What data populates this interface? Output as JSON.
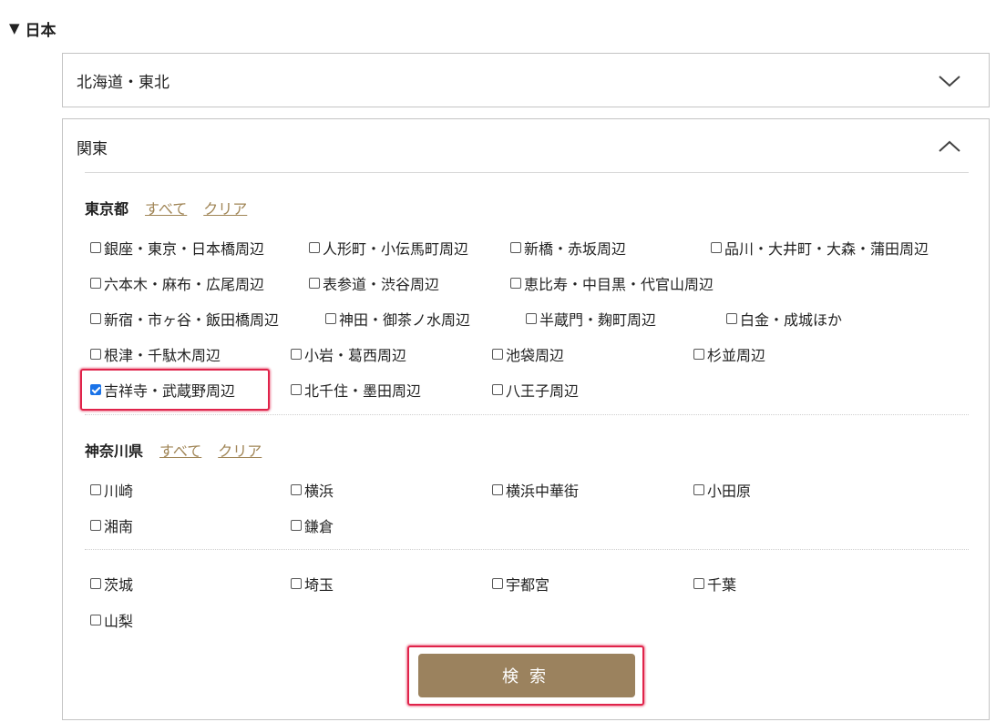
{
  "section": {
    "icon": "triangle-down-icon",
    "title": "日本"
  },
  "panels": [
    {
      "title": "北海道・東北",
      "expanded": false
    },
    {
      "title": "関東",
      "expanded": true
    }
  ],
  "tokyo": {
    "name": "東京都",
    "all_label": "すべて",
    "clear_label": "クリア",
    "options": [
      {
        "label": "銀座・東京・日本橋周辺",
        "checked": false
      },
      {
        "label": "人形町・小伝馬町周辺",
        "checked": false
      },
      {
        "label": "新橋・赤坂周辺",
        "checked": false
      },
      {
        "label": "品川・大井町・大森・蒲田周辺",
        "checked": false
      },
      {
        "label": "六本木・麻布・広尾周辺",
        "checked": false
      },
      {
        "label": "表参道・渋谷周辺",
        "checked": false
      },
      {
        "label": "恵比寿・中目黒・代官山周辺",
        "checked": false
      },
      {
        "label": "新宿・市ヶ谷・飯田橋周辺",
        "checked": false
      },
      {
        "label": "神田・御茶ノ水周辺",
        "checked": false
      },
      {
        "label": "半蔵門・麹町周辺",
        "checked": false
      },
      {
        "label": "白金・成城ほか",
        "checked": false
      },
      {
        "label": "根津・千駄木周辺",
        "checked": false
      },
      {
        "label": "小岩・葛西周辺",
        "checked": false
      },
      {
        "label": "池袋周辺",
        "checked": false
      },
      {
        "label": "杉並周辺",
        "checked": false
      },
      {
        "label": "吉祥寺・武蔵野周辺",
        "checked": true
      },
      {
        "label": "北千住・墨田周辺",
        "checked": false
      },
      {
        "label": "八王子周辺",
        "checked": false
      }
    ]
  },
  "kanagawa": {
    "name": "神奈川県",
    "all_label": "すべて",
    "clear_label": "クリア",
    "options": [
      {
        "label": "川崎",
        "checked": false
      },
      {
        "label": "横浜",
        "checked": false
      },
      {
        "label": "横浜中華街",
        "checked": false
      },
      {
        "label": "小田原",
        "checked": false
      },
      {
        "label": "湘南",
        "checked": false
      },
      {
        "label": "鎌倉",
        "checked": false
      }
    ]
  },
  "others": {
    "options": [
      {
        "label": "茨城",
        "checked": false
      },
      {
        "label": "埼玉",
        "checked": false
      },
      {
        "label": "宇都宮",
        "checked": false
      },
      {
        "label": "千葉",
        "checked": false
      },
      {
        "label": "山梨",
        "checked": false
      }
    ]
  },
  "search_button": {
    "label": "検索",
    "color": "#9b825e"
  },
  "colors": {
    "link": "#a08556",
    "highlight": "#e0234a",
    "checkbox_checked": "#1a73e8"
  }
}
